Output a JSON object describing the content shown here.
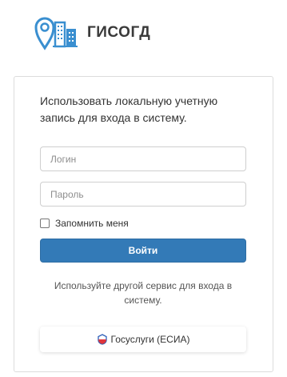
{
  "header": {
    "logo_text": "ГИСОГД",
    "logo_icon": "map-pin-buildings-icon"
  },
  "login_form": {
    "intro_text": "Использовать локальную учетную запись для входа в систему.",
    "login_placeholder": "Логин",
    "password_placeholder": "Пароль",
    "remember_label": "Запомнить меня",
    "remember_checked": false,
    "submit_label": "Войти"
  },
  "alternative": {
    "text": "Используйте другой сервис для входа в систему.",
    "esia_label": "Госуслуги (ЕСИА)",
    "esia_icon": "gosuslugi-logo-icon"
  },
  "colors": {
    "accent": "#337ab7",
    "logo_blue": "#3a8fd0"
  }
}
